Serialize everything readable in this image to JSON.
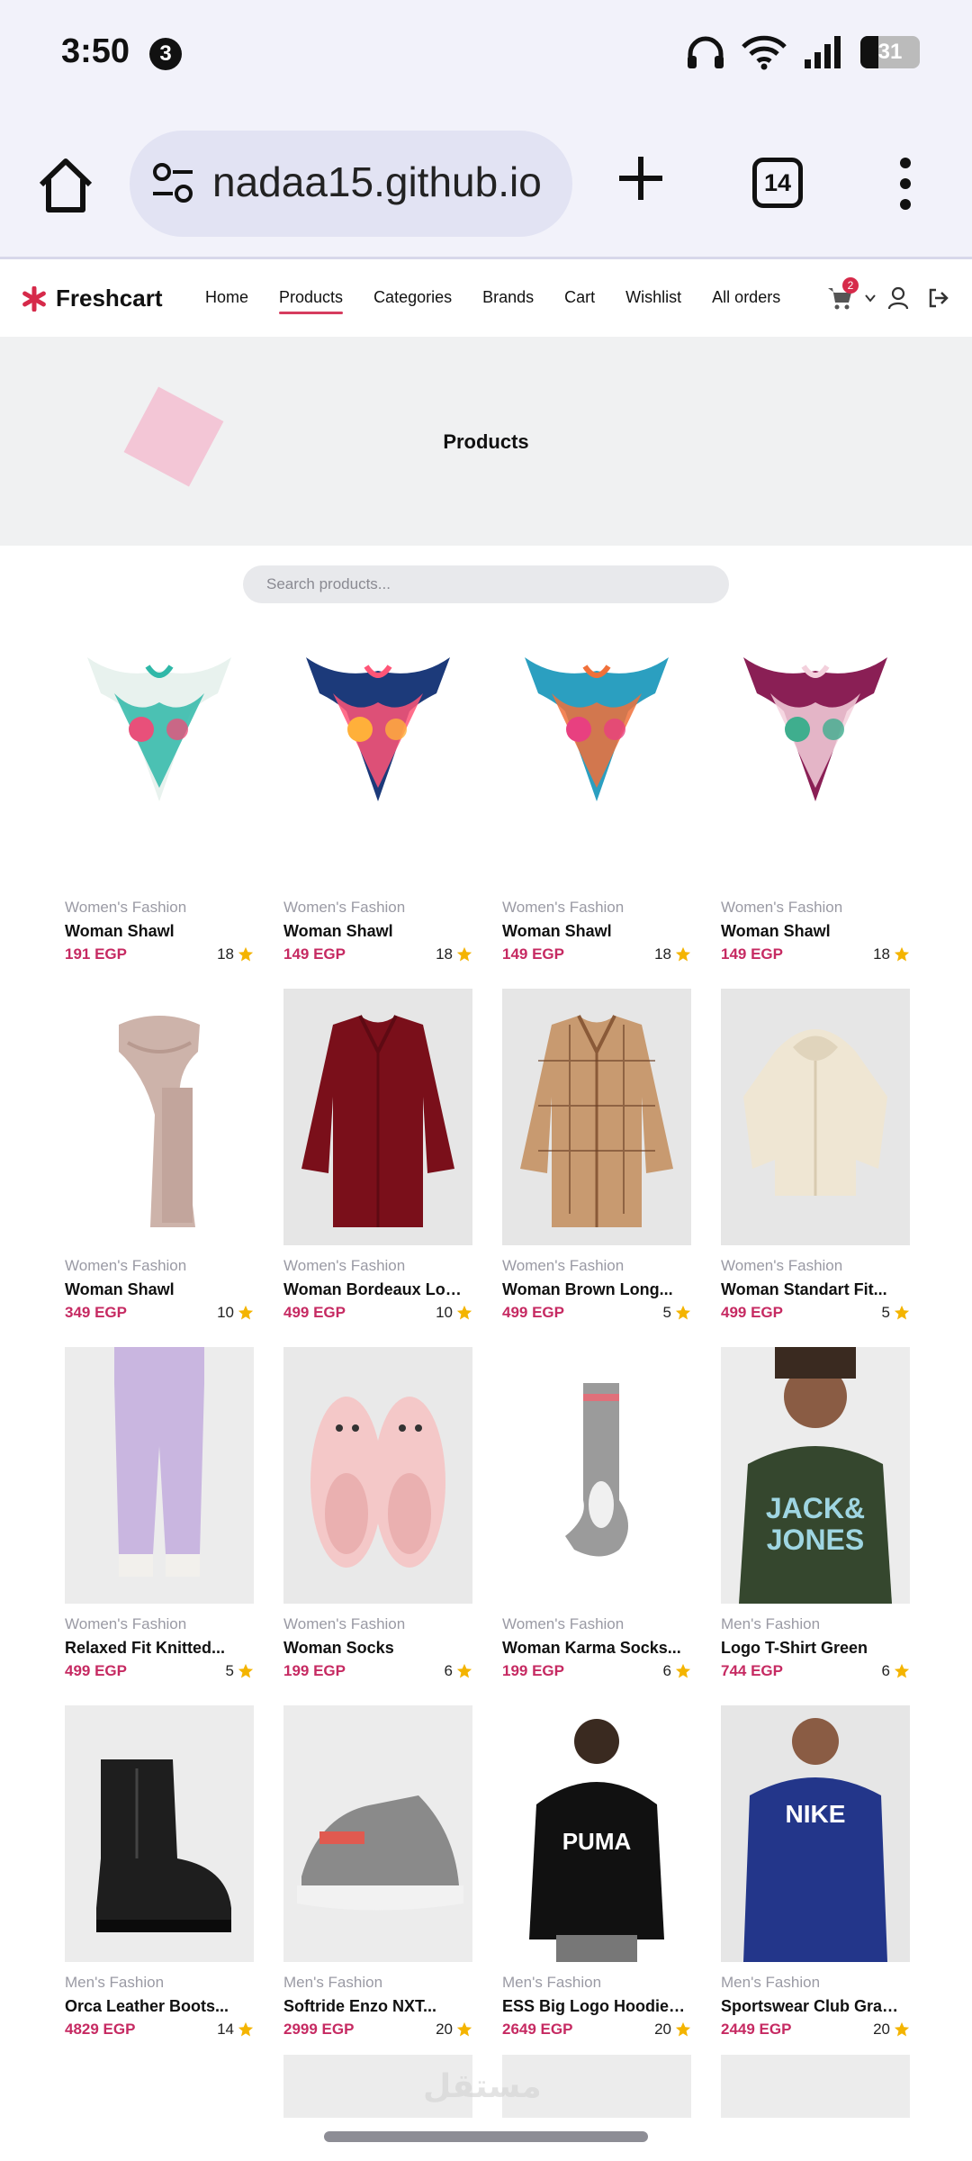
{
  "status": {
    "time": "3:50",
    "notification_count": "3",
    "battery": "31",
    "battery_level": 0.31
  },
  "browser": {
    "url": "nadaa15.github.io",
    "tab_count": "14"
  },
  "nav": {
    "brand": "Freshcart",
    "links": [
      "Home",
      "Products",
      "Categories",
      "Brands",
      "Cart",
      "Wishlist",
      "All orders"
    ],
    "active": "Products",
    "cart_count": "2"
  },
  "banner": {
    "title": "Products"
  },
  "search": {
    "placeholder": "Search products..."
  },
  "products": [
    {
      "category": "Women's Fashion",
      "title": "Woman Shawl",
      "price": "191 EGP",
      "rating": "18",
      "icon": "scarf-mint",
      "bg": "#ffffff"
    },
    {
      "category": "Women's Fashion",
      "title": "Woman Shawl",
      "price": "149 EGP",
      "rating": "18",
      "icon": "scarf-navy",
      "bg": "#ffffff"
    },
    {
      "category": "Women's Fashion",
      "title": "Woman Shawl",
      "price": "149 EGP",
      "rating": "18",
      "icon": "scarf-teal",
      "bg": "#ffffff"
    },
    {
      "category": "Women's Fashion",
      "title": "Woman Shawl",
      "price": "149 EGP",
      "rating": "18",
      "icon": "scarf-plum",
      "bg": "#ffffff"
    },
    {
      "category": "Women's Fashion",
      "title": "Woman Shawl",
      "price": "349 EGP",
      "rating": "10",
      "icon": "knit-scarf",
      "bg": "#ffffff"
    },
    {
      "category": "Women's Fashion",
      "title": "Woman Bordeaux Long...",
      "price": "499 EGP",
      "rating": "10",
      "icon": "burgundy-shirt",
      "bg": "#e6e6e6"
    },
    {
      "category": "Women's Fashion",
      "title": "Woman Brown Long...",
      "price": "499 EGP",
      "rating": "5",
      "icon": "plaid-shirt",
      "bg": "#e6e6e6"
    },
    {
      "category": "Women's Fashion",
      "title": "Woman Standart Fit...",
      "price": "499 EGP",
      "rating": "5",
      "icon": "cream-hoodie",
      "bg": "#e6e6e6"
    },
    {
      "category": "Women's Fashion",
      "title": "Relaxed Fit Knitted...",
      "price": "499 EGP",
      "rating": "5",
      "icon": "lilac-joggers",
      "bg": "#ececec"
    },
    {
      "category": "Women's Fashion",
      "title": "Woman Socks",
      "price": "199 EGP",
      "rating": "6",
      "icon": "fuzzy-slippers",
      "bg": "#e9e9e9"
    },
    {
      "category": "Women's Fashion",
      "title": "Woman Karma Socks...",
      "price": "199 EGP",
      "rating": "6",
      "icon": "grey-sock",
      "bg": "#ffffff"
    },
    {
      "category": "Men's Fashion",
      "title": "Logo T-Shirt Green",
      "price": "744 EGP",
      "rating": "6",
      "icon": "green-tshirt",
      "bg": "#ececec"
    },
    {
      "category": "Men's Fashion",
      "title": "Orca Leather Boots...",
      "price": "4829 EGP",
      "rating": "14",
      "icon": "black-boot",
      "bg": "#ececec"
    },
    {
      "category": "Men's Fashion",
      "title": "Softride Enzo NXT...",
      "price": "2999 EGP",
      "rating": "20",
      "icon": "grey-sneaker",
      "bg": "#ececec"
    },
    {
      "category": "Men's Fashion",
      "title": "ESS Big Logo Hoodie TR...",
      "price": "2649 EGP",
      "rating": "20",
      "icon": "black-hoodie",
      "bg": "#ffffff"
    },
    {
      "category": "Men's Fashion",
      "title": "Sportswear Club Graphi...",
      "price": "2449 EGP",
      "rating": "20",
      "icon": "navy-hoodie",
      "bg": "#e6e6e6"
    }
  ],
  "colors": {
    "accent": "#c62a62",
    "star": "#f4b400",
    "brand_star": "#d62a4a"
  }
}
